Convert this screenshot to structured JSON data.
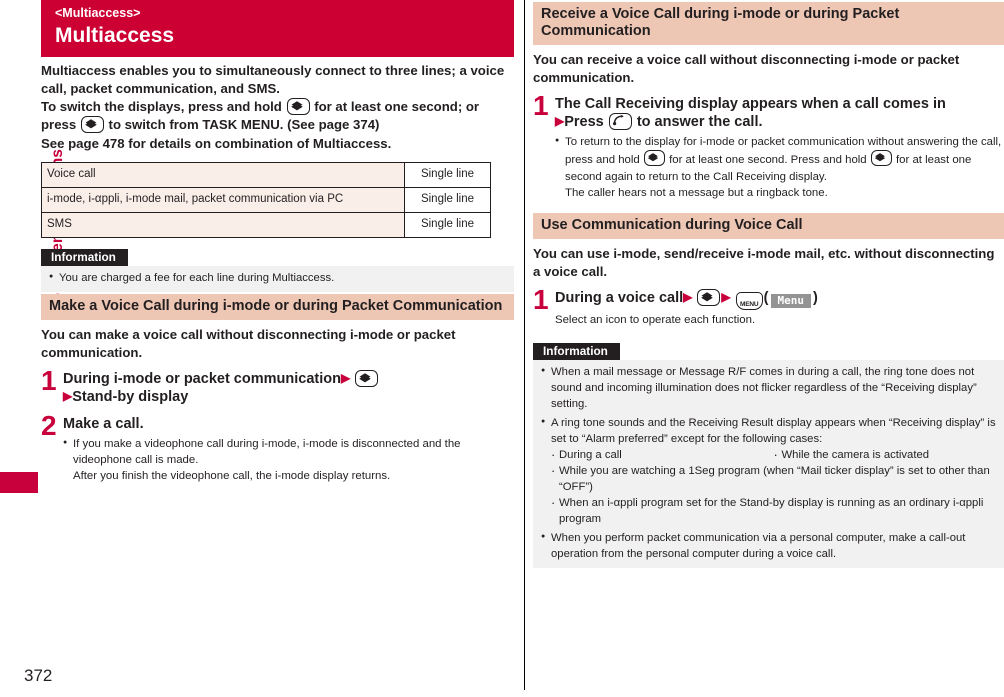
{
  "sidebar": {
    "chapter_label": "Convenient Functions",
    "page_number": "372",
    "accent_color": "#c8003c"
  },
  "left_column": {
    "banner": {
      "kicker": "<Multiaccess>",
      "title": "Multiaccess",
      "color": "#cc0033"
    },
    "intro": {
      "line1": "Multiaccess enables you to simultaneously connect to three lines; a voice call, packet communication, and SMS.",
      "line2_a": "To switch the displays, press and hold",
      "line2_b": "for at least one second; or press",
      "line2_c": "to switch from TASK MENU. (See page 374)",
      "line3": "See page 478 for details on combination of Multiaccess."
    },
    "table": {
      "rows": [
        {
          "name": "Voice call",
          "value": "Single line"
        },
        {
          "name": "i-mode, i-αppli, i-mode mail, packet communication via PC",
          "value": "Single line"
        },
        {
          "name": "SMS",
          "value": "Single line"
        }
      ]
    },
    "information": {
      "label": "Information",
      "items": [
        "You are charged a fee for each line during Multiaccess."
      ]
    },
    "section": {
      "header": "Make a Voice Call during i-mode or during Packet Communication",
      "lead": "You can make a voice call without disconnecting i-mode or packet communication.",
      "steps": [
        {
          "num": "1",
          "title_a": "During i-mode or packet communication",
          "title_b": "Stand-by display"
        },
        {
          "num": "2",
          "title": "Make a call.",
          "bullet_line1": "If you make a videophone call during i-mode, i-mode is disconnected and the videophone call is made.",
          "bullet_line2": "After you finish the videophone call, the i-mode display returns."
        }
      ]
    }
  },
  "right_column": {
    "section1": {
      "header": "Receive a Voice Call during i-mode or during Packet Communication",
      "lead": "You can receive a voice call without disconnecting i-mode or packet communication.",
      "step": {
        "num": "1",
        "title_a": "The Call Receiving display appears when a call comes in",
        "title_b_pre": "Press",
        "title_b_post": "to answer the call.",
        "bullet_line1": "To return to the display for i-mode or packet communication without answering the call, press and hold",
        "bullet_line2": "for at least one second. Press and hold",
        "bullet_line3": "for at least one second again to return to the Call Receiving display.",
        "bullet_line4": "The caller hears not a message but a ringback tone."
      }
    },
    "section2": {
      "header": "Use Communication during Voice Call",
      "lead": "You can use i-mode, send/receive i-mode mail, etc. without disconnecting a voice call.",
      "step": {
        "num": "1",
        "title_a": "During a voice call",
        "softkey_label": "Menu",
        "sub": "Select an icon to operate each function."
      }
    },
    "information": {
      "label": "Information",
      "item1_line1": "When a mail message or Message R/F comes in during a call, the ring tone does not sound and incoming illumination does not flicker regardless of the “Receiving display” setting.",
      "item2_line1": "A ring tone sounds and the Receiving Result display appears when “Receiving display” is set to “Alarm preferred” except for the following cases:",
      "item2_subs": [
        "During a call",
        "While the camera is activated",
        "While you are watching a 1Seg program (when “Mail ticker display” is set to other than “OFF”)",
        "When an i-αppli program set for the Stand-by display is running as an ordinary i-αppli program"
      ],
      "item3_line1": "When you perform packet communication via a personal computer, make a call-out operation from the personal computer during a voice call."
    }
  }
}
